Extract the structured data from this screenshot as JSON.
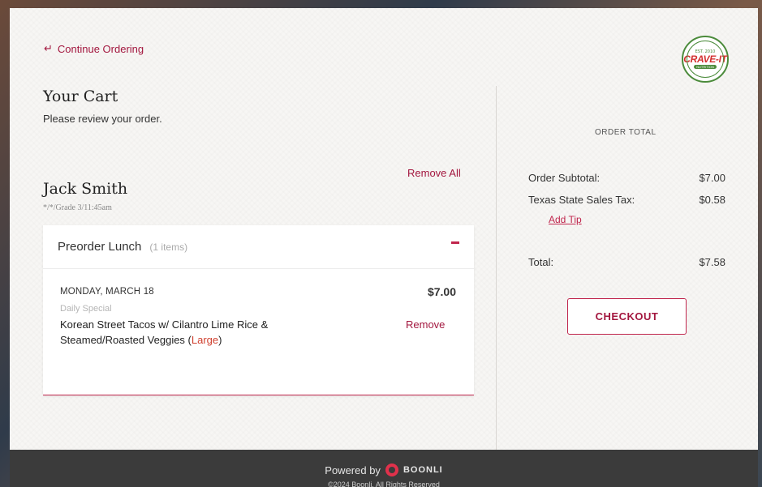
{
  "nav": {
    "continue_icon": "return-arrow-icon",
    "continue_label": "Continue Ordering"
  },
  "logo": {
    "est": "EST. 2010",
    "word": "CRAVE-IT",
    "sub": "NUTRITION"
  },
  "cart": {
    "title": "Your Cart",
    "subtitle": "Please review your order."
  },
  "student": {
    "name": "Jack Smith",
    "meta": "*/*/Grade 3/11:45am",
    "remove_all_label": "Remove All"
  },
  "order_group": {
    "title": "Preorder Lunch",
    "count": "(1 items)",
    "items": [
      {
        "date": "MONDAY, MARCH 18",
        "price": "$7.00",
        "category": "Daily Special",
        "name": "Korean Street Tacos w/ Cilantro Lime Rice & Steamed/Roasted Veggies (",
        "size": "Large",
        "name_end": ")",
        "remove_label": "Remove"
      }
    ]
  },
  "summary": {
    "heading": "ORDER TOTAL",
    "subtotal_label": "Order Subtotal:",
    "subtotal_value": "$7.00",
    "tax_label": "Texas State Sales Tax:",
    "tax_value": "$0.58",
    "add_tip_label": "Add Tip",
    "total_label": "Total:",
    "total_value": "$7.58",
    "checkout_label": "CHECKOUT"
  },
  "footer": {
    "powered_by": "Powered by",
    "brand": "BOONLI",
    "copyright": "©2024 Boonli. All Rights Reserved"
  },
  "colors": {
    "accent": "#a3173f",
    "size_text": "#d0402f",
    "footer_bg": "#3b3b3b"
  }
}
